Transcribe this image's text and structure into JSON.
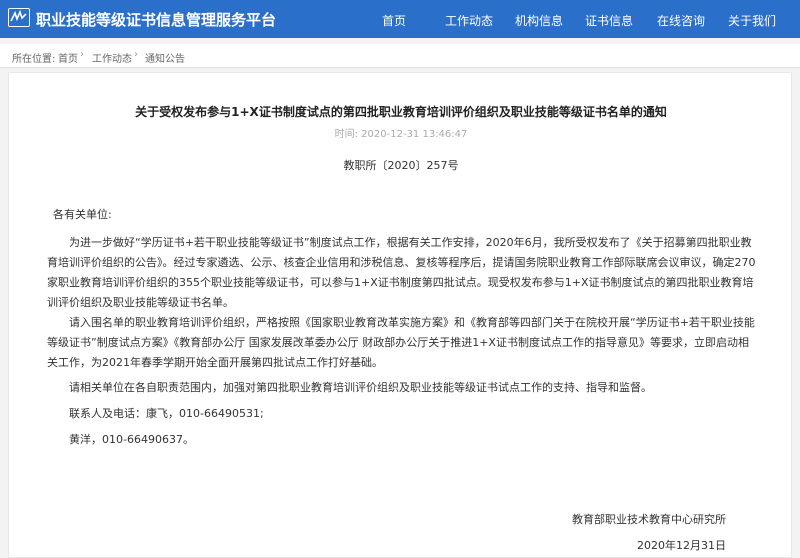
{
  "site": {
    "title": "职业技能等级证书信息管理服务平台"
  },
  "nav": {
    "items": [
      "首页",
      "工作动态",
      "机构信息",
      "证书信息",
      "在线咨询",
      "关于我们"
    ]
  },
  "breadcrumb": {
    "prefix": "所在位置:",
    "items": [
      "首页",
      "工作动态",
      "通知公告"
    ]
  },
  "article": {
    "title": "关于受权发布参与1+X证书制度试点的第四批职业教育培训评价组织及职业技能等级证书名单的通知",
    "time_label": "时间:",
    "time": "2020-12-31 13:46:47",
    "doc_no": "教职所〔2020〕257号",
    "salutation": "各有关单位:",
    "paragraphs": [
      "为进一步做好“学历证书+若干职业技能等级证书”制度试点工作，根据有关工作安排，2020年6月，我所受权发布了《关于招募第四批职业教育培训评价组织的公告》。经过专家遴选、公示、核查企业信用和涉税信息、复核等程序后，提请国务院职业教育工作部际联席会议审议，确定270家职业教育培训评价组织的355个职业技能等级证书，可以参与1+X证书制度第四批试点。现受权发布参与1+X证书制度试点的第四批职业教育培训评价组织及职业技能等级证书名单。",
      "请入围名单的职业教育培训评价组织，严格按照《国家职业教育改革实施方案》和《教育部等四部门关于在院校开展“学历证书+若干职业技能等级证书”制度试点方案》《教育部办公厅 国家发展改革委办公厅 财政部办公厅关于推进1+X证书制度试点工作的指导意见》等要求，立即启动相关工作，为2021年春季学期开始全面开展第四批试点工作打好基础。",
      "请相关单位在各自职责范围内，加强对第四批职业教育培训评价组织及职业技能等级证书试点工作的支持、指导和监督。",
      "联系人及电话：康飞，010-66490531;",
      "黄洋，010-66490637。"
    ],
    "signature": "教育部职业技术教育中心研究所",
    "date": "2020年12月31日"
  }
}
